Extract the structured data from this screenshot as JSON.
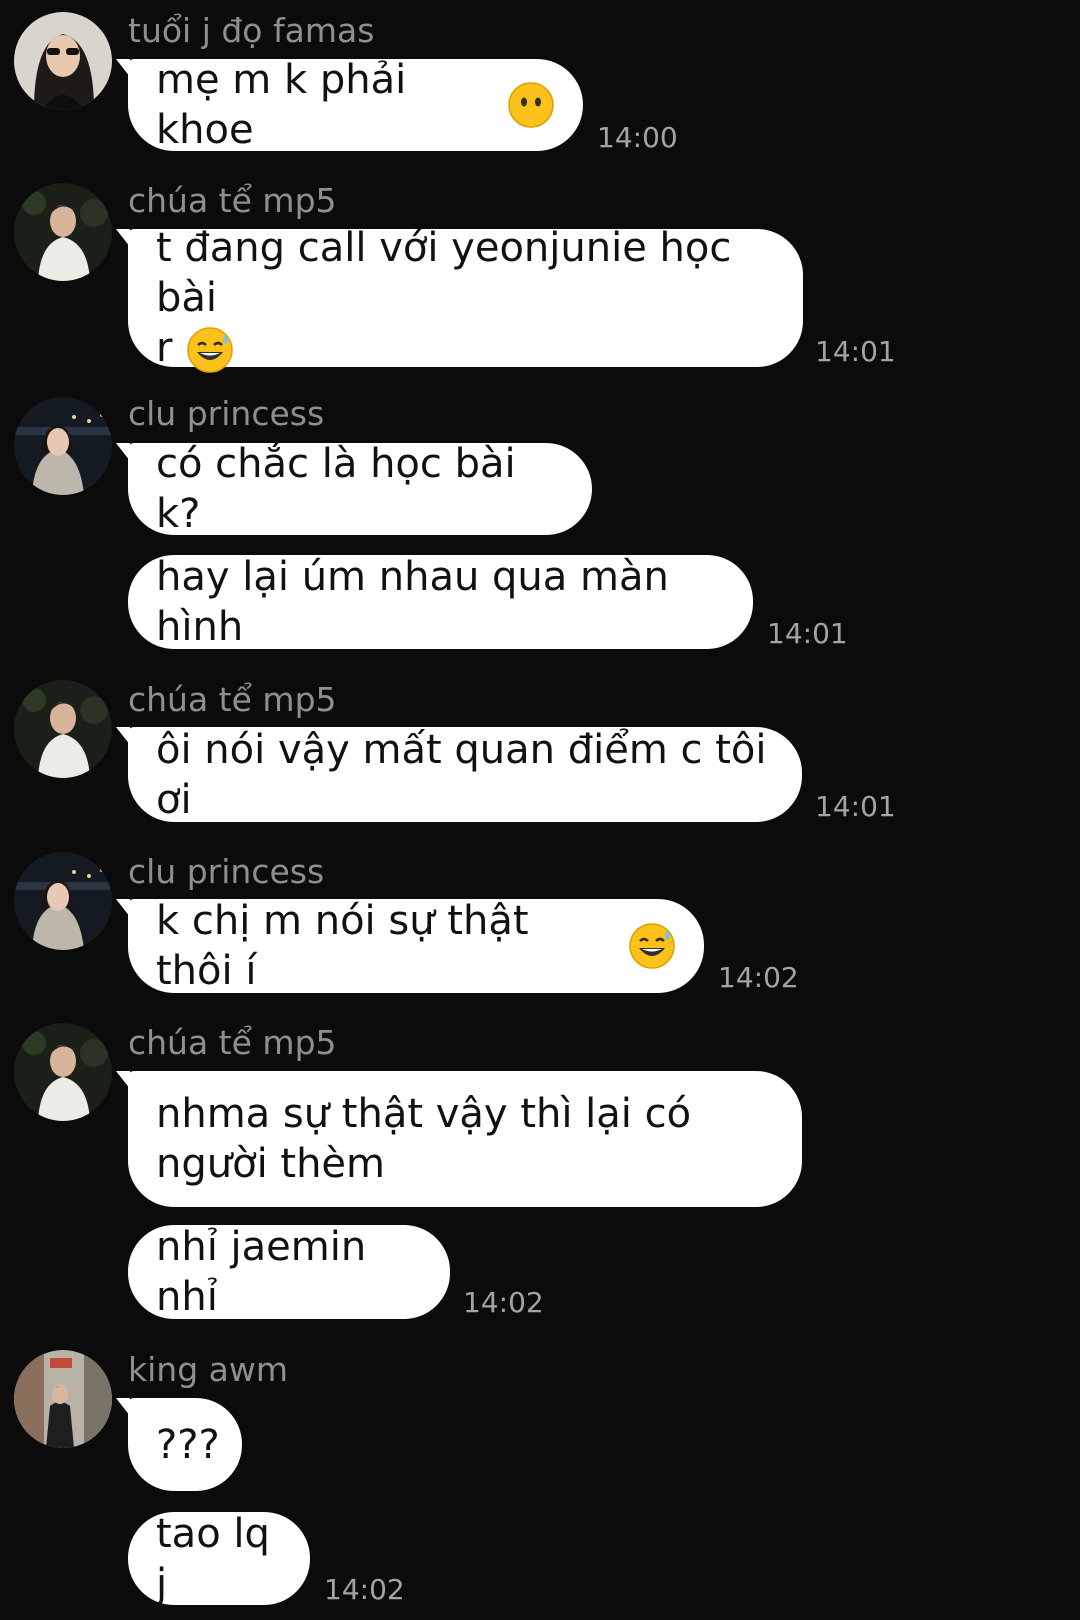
{
  "messages": [
    {
      "sender": "tuổi j đọ famas",
      "avatar": "avatar-girl-sunglasses",
      "lines": [
        "mẹ m k phải khoe"
      ],
      "emoji": "neutral-face-emoji",
      "time": "14:00"
    },
    {
      "sender": "chúa tể mp5",
      "avatar": "avatar-boy-white-shirt",
      "lines": [
        "t đang call với yeonjunie học bài",
        "r"
      ],
      "emoji": "sweat-smile-emoji",
      "time": "14:01"
    },
    {
      "sender": "clu princess",
      "avatar": "avatar-girl-night-city",
      "lines": [
        "có chắc là học bài k?"
      ],
      "emoji": null,
      "time": null
    },
    {
      "sender": null,
      "avatar": null,
      "lines": [
        "hay lại úm nhau qua màn hình"
      ],
      "emoji": null,
      "time": "14:01"
    },
    {
      "sender": "chúa tể mp5",
      "avatar": "avatar-boy-white-shirt",
      "lines": [
        "ôi nói vậy mất quan điểm c tôi ơi"
      ],
      "emoji": null,
      "time": "14:01"
    },
    {
      "sender": "clu princess",
      "avatar": "avatar-girl-night-city",
      "lines": [
        "k chị m nói sự thật thôi í"
      ],
      "emoji": "sweat-smile-emoji",
      "time": "14:02"
    },
    {
      "sender": "chúa tể mp5",
      "avatar": "avatar-boy-white-shirt",
      "lines": [
        "nhma sự thật vậy thì lại có",
        "người thèm"
      ],
      "emoji": null,
      "time": null
    },
    {
      "sender": null,
      "avatar": null,
      "lines": [
        "nhỉ jaemin nhỉ"
      ],
      "emoji": null,
      "time": "14:02"
    },
    {
      "sender": "king awm",
      "avatar": "avatar-boy-street",
      "lines": [
        "???"
      ],
      "emoji": null,
      "time": null
    },
    {
      "sender": null,
      "avatar": null,
      "lines": [
        "tao lq j"
      ],
      "emoji": null,
      "time": "14:02"
    }
  ],
  "colors": {
    "background": "#0b0b0b",
    "bubble": "#ffffff",
    "name": "#8f8f8f",
    "time": "#a3a3a3",
    "text": "#111111"
  }
}
